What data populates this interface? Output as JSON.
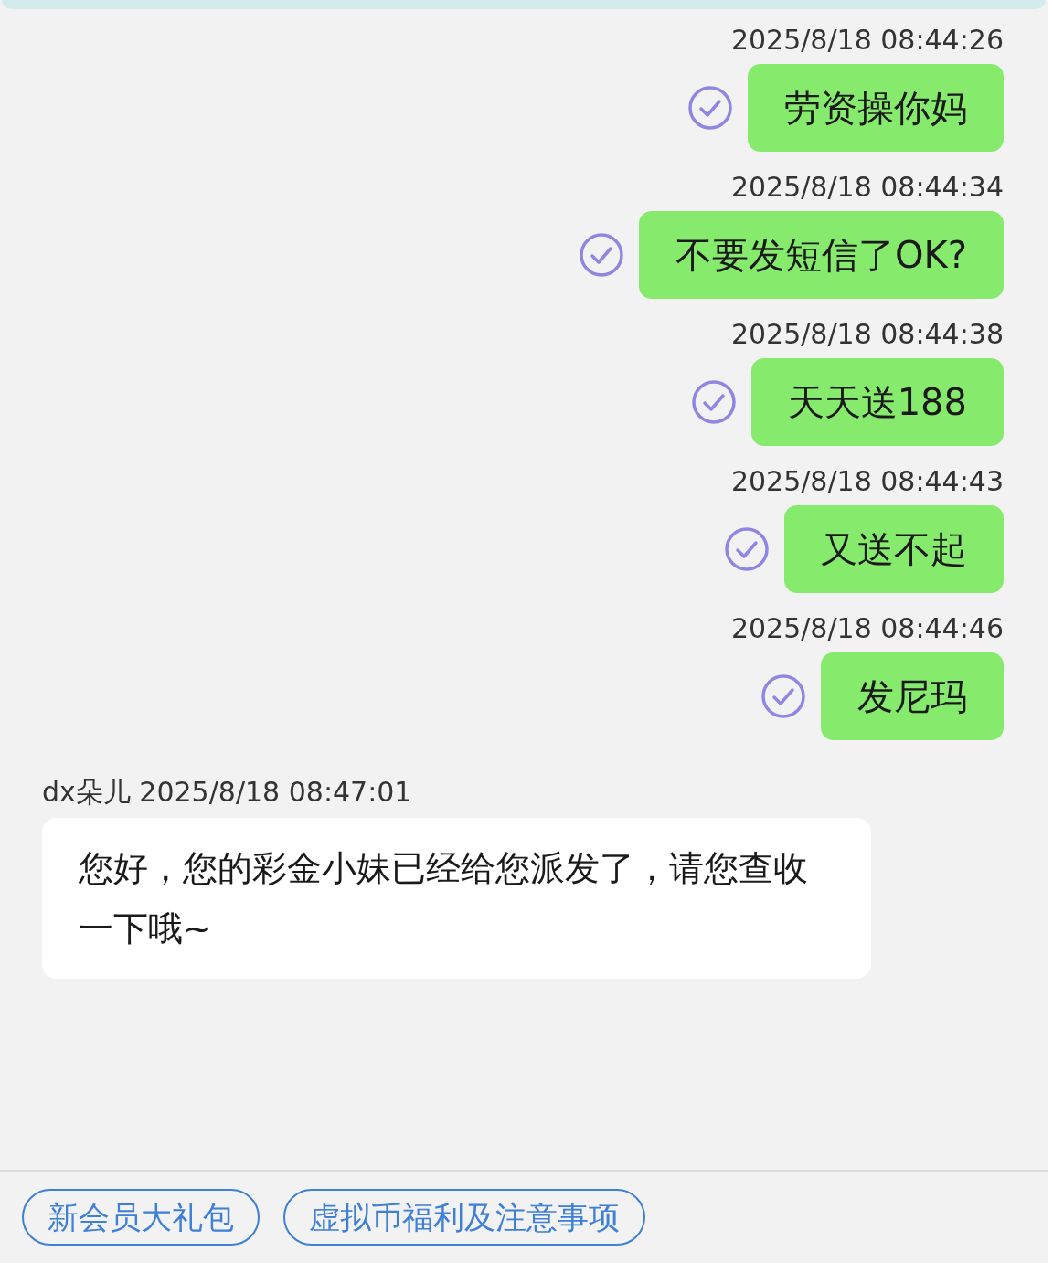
{
  "messages": [
    {
      "kind": "sent",
      "time": "2025/8/18 08:44:26",
      "text": "劳资操你妈"
    },
    {
      "kind": "sent",
      "time": "2025/8/18 08:44:34",
      "text": "不要发短信了OK?"
    },
    {
      "kind": "sent",
      "time": "2025/8/18 08:44:38",
      "text": "天天送188"
    },
    {
      "kind": "sent",
      "time": "2025/8/18 08:44:43",
      "text": "又送不起"
    },
    {
      "kind": "sent",
      "time": "2025/8/18 08:44:46",
      "text": "发尼玛"
    },
    {
      "kind": "received",
      "sender": "dx朵儿",
      "time": "2025/8/18 08:47:01",
      "text": "您好，您的彩金小妹已经给您派发了，请您查收一下哦~"
    }
  ],
  "quick_replies": [
    "新会员大礼包",
    "虚拟币福利及注意事项"
  ]
}
